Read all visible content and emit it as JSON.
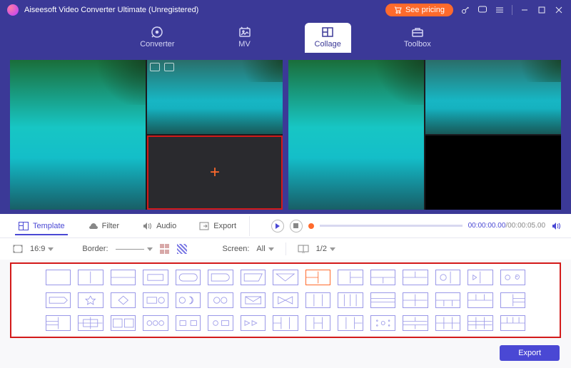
{
  "titlebar": {
    "app_title": "Aiseesoft Video Converter Ultimate (Unregistered)",
    "see_pricing": "See pricing"
  },
  "nav": {
    "items": [
      {
        "label": "Converter"
      },
      {
        "label": "MV"
      },
      {
        "label": "Collage"
      },
      {
        "label": "Toolbox"
      }
    ],
    "active_index": 2
  },
  "tabs": {
    "items": [
      {
        "label": "Template"
      },
      {
        "label": "Filter"
      },
      {
        "label": "Audio"
      },
      {
        "label": "Export"
      }
    ],
    "active_index": 0
  },
  "playback": {
    "current": "00:00:00.00",
    "total": "00:00:05.00"
  },
  "controls": {
    "ratio": "16:9",
    "border_label": "Border:",
    "screen_label": "Screen:",
    "screen_value": "All",
    "split_value": "1/2"
  },
  "footer": {
    "export": "Export"
  }
}
